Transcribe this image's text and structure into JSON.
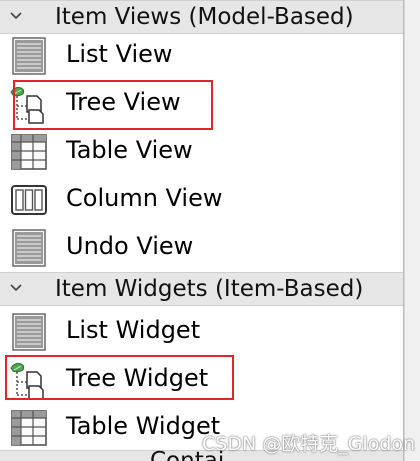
{
  "categories": [
    {
      "label": "Item Views (Model-Based)",
      "icon": "chevron-down-icon"
    },
    {
      "label": "Item Widgets (Item-Based)",
      "icon": "chevron-down-icon"
    },
    {
      "label": "Contai"
    }
  ],
  "item_views": [
    {
      "label": "List View",
      "icon": "list-view-icon"
    },
    {
      "label": "Tree View",
      "icon": "tree-view-icon"
    },
    {
      "label": "Table View",
      "icon": "table-view-icon"
    },
    {
      "label": "Column View",
      "icon": "column-view-icon"
    },
    {
      "label": "Undo View",
      "icon": "undo-view-icon"
    }
  ],
  "item_widgets": [
    {
      "label": "List Widget",
      "icon": "list-widget-icon"
    },
    {
      "label": "Tree Widget",
      "icon": "tree-widget-icon"
    },
    {
      "label": "Table Widget",
      "icon": "table-widget-icon"
    }
  ],
  "highlights": [
    {
      "target": "Tree View",
      "color": "#e3242b"
    },
    {
      "target": "Tree Widget",
      "color": "#e3242b"
    }
  ],
  "watermark": "CSDN @欧特克_Glodon",
  "colors": {
    "category_bg": "#e6e6e6",
    "highlight": "#e3242b"
  }
}
